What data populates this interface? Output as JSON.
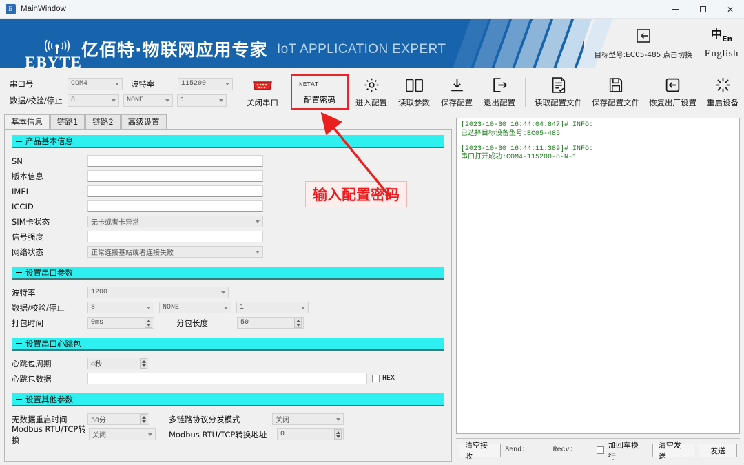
{
  "window": {
    "title": "MainWindow",
    "icon": "app-icon",
    "minimize": "–",
    "maximize": "□",
    "close": "✕"
  },
  "banner": {
    "logo_text": "EBYTE",
    "registered": "®",
    "title_cn": "亿佰特·物联网应用专家",
    "title_en": "IoT APPLICATION EXPERT",
    "model_switch_label": "目标型号:EC05-485 点击切换",
    "language_label": "English",
    "language_icon_cn": "中",
    "language_icon_en": "En"
  },
  "serial": {
    "port_label": "串口号",
    "port_value": "COM4",
    "baud_label": "波特率",
    "baud_value": "115200",
    "format_label": "数据/校验/停止",
    "data_bits": "8",
    "parity": "NONE",
    "stop_bits": "1",
    "close_port_label": "关闭串口"
  },
  "password": {
    "value": "NETAT",
    "label": "配置密码",
    "placeholder": "NETAT"
  },
  "toolbar": {
    "enter_config": "进入配置",
    "read_params": "读取参数",
    "save_config": "保存配置",
    "exit_config": "退出配置",
    "read_file": "读取配置文件",
    "save_file": "保存配置文件",
    "factory_reset": "恢复出厂设置",
    "restart_device": "重启设备"
  },
  "tabs": [
    {
      "label": "基本信息",
      "active": true
    },
    {
      "label": "链路1",
      "active": false
    },
    {
      "label": "链路2",
      "active": false
    },
    {
      "label": "高级设置",
      "active": false
    }
  ],
  "product_info": {
    "section_title": "产品基本信息",
    "fields": [
      {
        "label": "SN",
        "value": "",
        "type": "input"
      },
      {
        "label": "版本信息",
        "value": "",
        "type": "input"
      },
      {
        "label": "IMEI",
        "value": "",
        "type": "input"
      },
      {
        "label": "ICCID",
        "value": "",
        "type": "input"
      },
      {
        "label": "SIM卡状态",
        "value": "无卡或者卡异常",
        "type": "combo"
      },
      {
        "label": "信号强度",
        "value": "",
        "type": "input"
      },
      {
        "label": "网络状态",
        "value": "正常连接基站或者连接失败",
        "type": "combo"
      }
    ]
  },
  "serial_params": {
    "section_title": "设置串口参数",
    "baud_label": "波特率",
    "baud_value": "1200",
    "format_label": "数据/校验/停止",
    "data_bits": "8",
    "parity": "NONE",
    "stop_bits": "1",
    "pack_time_label": "打包时间",
    "pack_time_value": "0ms",
    "pack_len_label": "分包长度",
    "pack_len_value": "50"
  },
  "heartbeat": {
    "section_title": "设置串口心跳包",
    "period_label": "心跳包周期",
    "period_value": "0秒",
    "data_label": "心跳包数据",
    "data_value": "",
    "hex_label": "HEX",
    "hex_checked": false
  },
  "other_params": {
    "section_title": "设置其他参数",
    "nodata_restart_label": "无数据重启时间",
    "nodata_restart_value": "30分",
    "multilink_label": "多链路协议分发模式",
    "multilink_value": "关闭",
    "modbus_label": "Modbus RTU/TCP转换",
    "modbus_value": "关闭",
    "modbus_addr_label": "Modbus RTU/TCP转换地址",
    "modbus_addr_value": "0"
  },
  "log": {
    "lines": [
      "[2023-10-30 16:44:04.847]# INFO:",
      "已选择目标设备型号:EC05-485",
      "",
      "[2023-10-30 16:44:11.389]# INFO:",
      "串口打开成功:COM4-115200-8-N-1"
    ]
  },
  "sendbar": {
    "clear_recv": "清空接收",
    "send_count": "Send:",
    "recv_count": "Recv:",
    "crlf_label": "加回车换行",
    "crlf_checked": false,
    "clear_send": "清空发送",
    "send": "发送"
  },
  "annotation": {
    "text": "输入配置密码",
    "color": "#ee1c1c"
  },
  "colors": {
    "brand_blue": "#1763ac",
    "section_cyan": "#2ef0f0",
    "log_green": "#1a7a1a",
    "accent_red": "#e8262a"
  }
}
